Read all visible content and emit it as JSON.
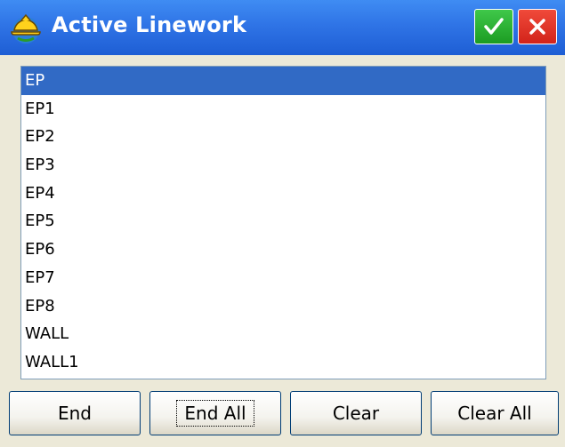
{
  "window": {
    "title": "Active Linework",
    "app_icon": "construction-helmet-icon",
    "ok_icon": "checkmark-icon",
    "close_icon": "x-icon"
  },
  "list": {
    "selected_index": 0,
    "items": [
      {
        "label": "EP"
      },
      {
        "label": "EP1"
      },
      {
        "label": "EP2"
      },
      {
        "label": "EP3"
      },
      {
        "label": "EP4"
      },
      {
        "label": "EP5"
      },
      {
        "label": "EP6"
      },
      {
        "label": "EP7"
      },
      {
        "label": "EP8"
      },
      {
        "label": "WALL"
      },
      {
        "label": "WALL1"
      }
    ]
  },
  "buttons": {
    "end": "End",
    "end_all": "End All",
    "clear": "Clear",
    "clear_all": "Clear All"
  },
  "colors": {
    "titlebar": "#2f74e6",
    "selection": "#316ac5",
    "ok": "#1c9c22",
    "close": "#d2231a"
  }
}
